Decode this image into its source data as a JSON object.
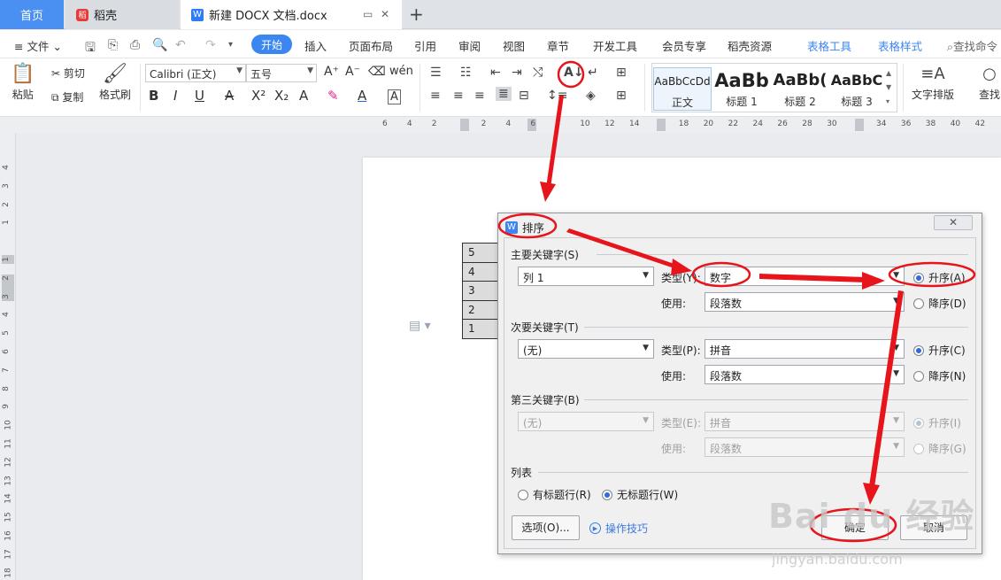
{
  "tabs": {
    "home": "首页",
    "daoke": "稻壳",
    "doc": "新建 DOCX 文档.docx"
  },
  "menu": {
    "file": "文件",
    "items": [
      "开始",
      "插入",
      "页面布局",
      "引用",
      "审阅",
      "视图",
      "章节",
      "开发工具",
      "会员专享",
      "稻壳资源"
    ],
    "table_tools": "表格工具",
    "table_style": "表格样式",
    "search": "查找命令"
  },
  "ribbon": {
    "paste": "粘贴",
    "cut": "剪切",
    "copy": "复制",
    "format_painter": "格式刷",
    "font_name": "Calibri (正文)",
    "font_size": "五号",
    "styles": [
      {
        "sample": "AaBbCcDd",
        "name": "正文"
      },
      {
        "sample": "AaBb",
        "name": "标题 1"
      },
      {
        "sample": "AaBb(",
        "name": "标题 2"
      },
      {
        "sample": "AaBbC",
        "name": "标题 3"
      }
    ],
    "text_layout": "文字排版",
    "find": "查找"
  },
  "ruler": {
    "h_ticks": [
      "6",
      "4",
      "2",
      "",
      "2",
      "4",
      "6",
      "8",
      "10",
      "12",
      "14",
      "",
      "18",
      "20",
      "22",
      "24",
      "26",
      "28",
      "30",
      "",
      "34",
      "36",
      "38",
      "40",
      "42"
    ],
    "v_ticks": [
      "4",
      "3",
      "2",
      "1",
      "",
      "1",
      "2",
      "3",
      "4",
      "5",
      "6",
      "7",
      "8",
      "9",
      "10",
      "11",
      "12",
      "13",
      "14",
      "15",
      "16",
      "17",
      "18"
    ]
  },
  "document": {
    "table_values": [
      "5",
      "4",
      "3",
      "2",
      "1"
    ]
  },
  "dialog": {
    "title": "排序",
    "primary": {
      "label": "主要关键字(S)",
      "column": "列 1",
      "type_label": "类型(Y):",
      "type_value": "数字",
      "use_label": "使用:",
      "use_value": "段落数",
      "asc": "升序(A)",
      "desc": "降序(D)"
    },
    "secondary": {
      "label": "次要关键字(T)",
      "column": "(无)",
      "type_label": "类型(P):",
      "type_value": "拼音",
      "use_label": "使用:",
      "use_value": "段落数",
      "asc": "升序(C)",
      "desc": "降序(N)"
    },
    "third": {
      "label": "第三关键字(B)",
      "column": "(无)",
      "type_label": "类型(E):",
      "type_value": "拼音",
      "use_label": "使用:",
      "use_value": "段落数",
      "asc": "升序(I)",
      "desc": "降序(G)"
    },
    "list": {
      "label": "列表",
      "has_header": "有标题行(R)",
      "no_header": "无标题行(W)"
    },
    "options_button": "选项(O)...",
    "tips": "操作技巧",
    "ok": "确定",
    "cancel": "取消"
  },
  "watermark": {
    "logo": "Bai du 经验",
    "url": "jingyan.baidu.com"
  },
  "colors": {
    "accent": "#3b86f0",
    "annotation": "#e8141c"
  }
}
